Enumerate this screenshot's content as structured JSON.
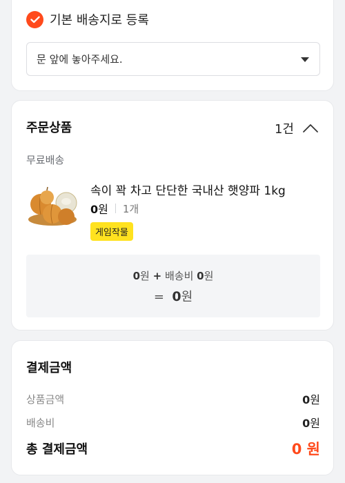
{
  "address": {
    "default_label": "기본 배송지로 등록",
    "request_select_value": "문 앞에 놓아주세요."
  },
  "order": {
    "title": "주문상품",
    "count": "1건",
    "shipping_type": "무료배송",
    "product": {
      "name": "속이 꽉 차고 단단한 국내산 햇양파 1kg",
      "price_amount": "0",
      "price_unit": "원",
      "quantity": "1개",
      "badge": "게임작물"
    },
    "summary": {
      "product_amount": "0",
      "product_unit": "원",
      "plus": "+",
      "shipping_label": "배송비",
      "shipping_amount": "0",
      "shipping_unit": "원",
      "equals": "=",
      "total_amount": "0",
      "total_unit": "원"
    }
  },
  "payment": {
    "title": "결제금액",
    "product_label": "상품금액",
    "product_amount": "0",
    "product_unit": "원",
    "shipping_label": "배송비",
    "shipping_amount": "0",
    "shipping_unit": "원",
    "total_label": "총 결제금액",
    "total_value": "0 원"
  },
  "colors": {
    "accent": "#ff4a1c",
    "badge": "#ffe21f",
    "background": "#f2f3f5"
  },
  "icons": {
    "default_check": "check-icon",
    "select_caret": "caret-down-icon",
    "collapse": "chevron-up-icon",
    "product_image": "onion-product-image"
  }
}
